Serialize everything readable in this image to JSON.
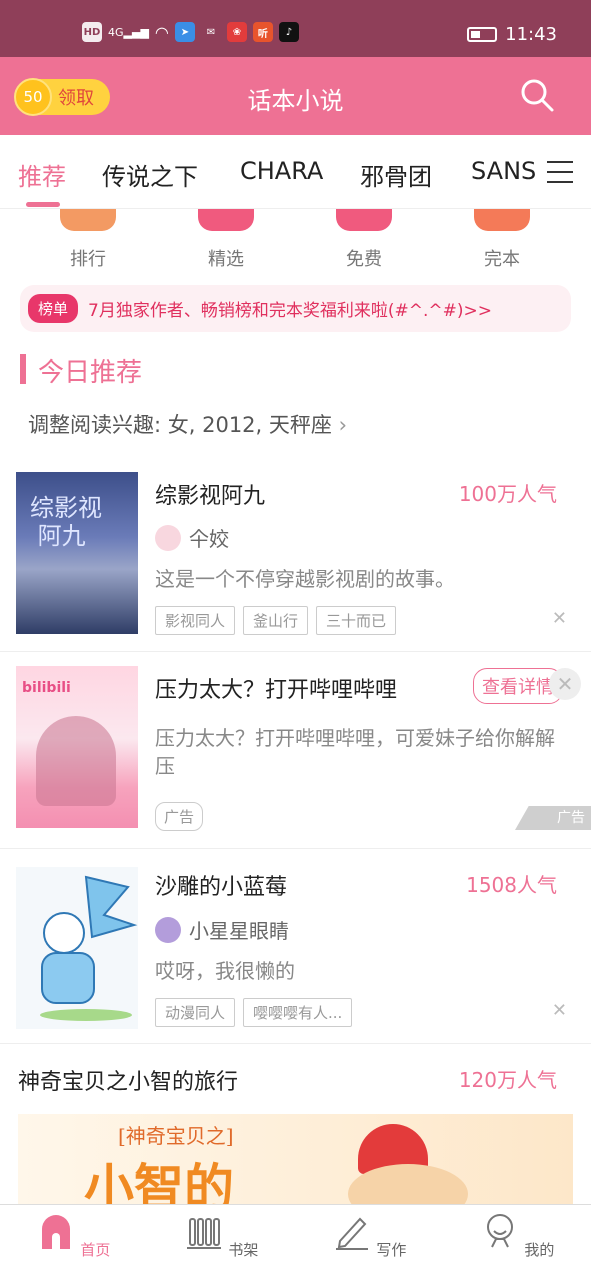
{
  "status_bar": {
    "left_icons": [
      "HD",
      "4G",
      "wifi-icon",
      "app-icons"
    ],
    "time": "11:43"
  },
  "header": {
    "coin_value": "50",
    "coin_label": "领取",
    "title": "话本小说"
  },
  "tabs": [
    {
      "label": "推荐",
      "active": true
    },
    {
      "label": "传说之下"
    },
    {
      "label": "CHARA"
    },
    {
      "label": "邪骨团"
    },
    {
      "label": "SANS"
    }
  ],
  "categories": [
    {
      "label": "排行",
      "color": "#f39a63"
    },
    {
      "label": "精选",
      "color": "#f05a7e"
    },
    {
      "label": "免费",
      "color": "#f05a7e"
    },
    {
      "label": "完本",
      "color": "#f47a58"
    }
  ],
  "notice": {
    "tag": "榜单",
    "text": "7月独家作者、畅销榜和完本奖福利来啦(#^.^#)>>"
  },
  "section": {
    "title": "今日推荐",
    "interest": "调整阅读兴趣: 女, 2012, 天秤座"
  },
  "books": [
    {
      "title": "综影视阿九",
      "popularity": "100万人气",
      "author": "仐姣",
      "desc": "这是一个不停穿越影视剧的故事。",
      "tags": [
        "影视同人",
        "釜山行",
        "三十而已"
      ]
    },
    {
      "title": "沙雕的小蓝莓",
      "popularity": "1508人气",
      "author": "小星星眼睛",
      "desc": "哎呀，我很懒的",
      "tags": [
        "动漫同人",
        "嘤嘤嘤有人..."
      ]
    },
    {
      "title": "神奇宝贝之小智的旅行",
      "popularity": "120万人气"
    }
  ],
  "ad": {
    "title": "压力太大？打开哔哩哔哩",
    "button": "查看详情",
    "desc": "压力太大？打开哔哩哔哩，可爱妹子给你解解压",
    "label": "广告",
    "corner": "广告"
  },
  "bottom_nav": [
    {
      "label": "首页",
      "active": true,
      "icon": "home-icon"
    },
    {
      "label": "书架",
      "icon": "bookshelf-icon"
    },
    {
      "label": "写作",
      "icon": "pen-icon"
    },
    {
      "label": "我的",
      "icon": "profile-icon"
    }
  ],
  "colors": {
    "brand": "#ee7194",
    "status_bar": "#8f3f59"
  }
}
